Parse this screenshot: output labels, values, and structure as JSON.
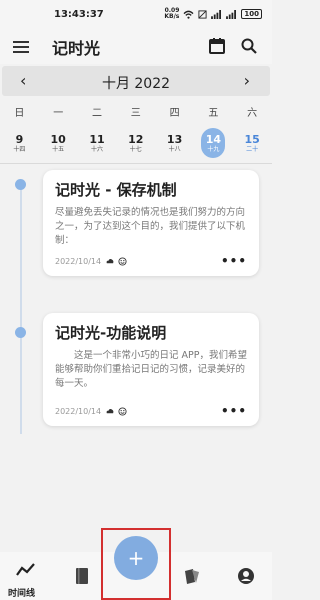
{
  "status_bar": {
    "time": "13:43:37",
    "net_speed_value": "0.09",
    "net_speed_unit": "KB/s",
    "battery": "100"
  },
  "app_bar": {
    "title": "记时光"
  },
  "calendar": {
    "month_label": "十月 2022",
    "prev": "‹",
    "next": "›",
    "weekdays": [
      "日",
      "一",
      "二",
      "三",
      "四",
      "五",
      "六"
    ],
    "dates": [
      {
        "day": "9",
        "lunar": "十四"
      },
      {
        "day": "10",
        "lunar": "十五"
      },
      {
        "day": "11",
        "lunar": "十六"
      },
      {
        "day": "12",
        "lunar": "十七"
      },
      {
        "day": "13",
        "lunar": "十八"
      },
      {
        "day": "14",
        "lunar": "十九"
      },
      {
        "day": "15",
        "lunar": "二十"
      }
    ]
  },
  "entries": [
    {
      "title": "记时光 - 保存机制",
      "body": "尽量避免丢失记录的情况也是我们努力的方向之一，为了达到这个目的，我们提供了以下机制：",
      "date": "2022/10/14",
      "more": "•••"
    },
    {
      "title": "记时光-功能说明",
      "body": "这是一个非常小巧的日记 APP，我们希望能够帮助你们重拾记日记的习惯，记录美好的每一天。",
      "date": "2022/10/14",
      "more": "•••"
    }
  ],
  "bottom_nav": {
    "timeline_label": "时间线",
    "fab_symbol": "+"
  },
  "colors": {
    "accent": "#8ab4e6",
    "highlight_box": "#d32f2f"
  }
}
